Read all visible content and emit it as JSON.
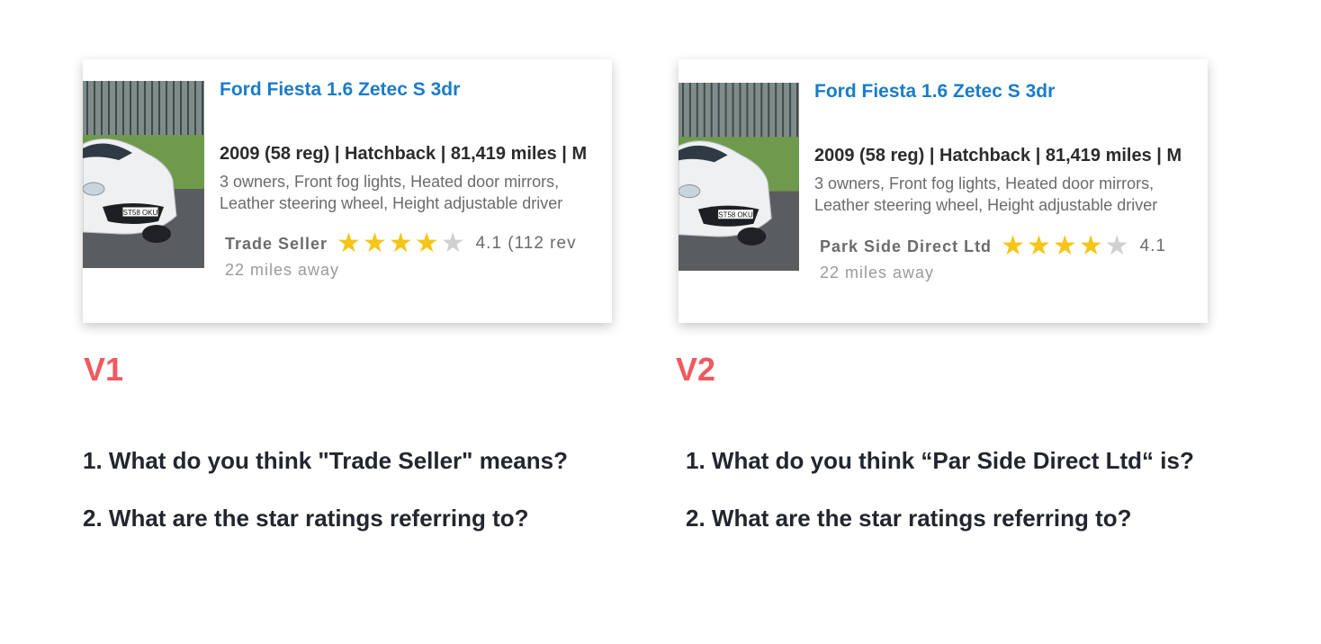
{
  "variants": [
    {
      "label": "V1",
      "card": {
        "title": "Ford Fiesta 1.6 Zetec S 3dr",
        "spec": "2009 (58 reg) | Hatchback | 81,419 miles | M",
        "features_line1": "3 owners, Front fog lights, Heated door mirrors,",
        "features_line2": "Leather steering wheel, Height adjustable driver",
        "seller": "Trade Seller",
        "stars_filled": 4,
        "stars_total": 5,
        "rating_text": "4.1 (112 rev",
        "distance": "22 miles away",
        "plate": "ST58 OKU"
      },
      "questions": [
        "1. What do you think \"Trade Seller\" means?",
        "2. What are the star ratings referring to?"
      ]
    },
    {
      "label": "V2",
      "card": {
        "title": "Ford Fiesta 1.6 Zetec S 3dr",
        "spec": "2009 (58 reg) | Hatchback | 81,419 miles | M",
        "features_line1": "3 owners, Front fog lights, Heated door mirrors,",
        "features_line2": "Leather steering wheel, Height adjustable driver",
        "seller": "Park Side Direct Ltd",
        "stars_filled": 4,
        "stars_total": 5,
        "rating_text": "4.1",
        "distance": "22 miles away",
        "plate": "ST58 OKU"
      },
      "questions": [
        "1. What do you think “Par Side Direct Ltd“ is?",
        "2. What are the star ratings referring to?"
      ]
    }
  ],
  "colors": {
    "title_blue": "#1a7cc8",
    "version_red": "#ef5a5f",
    "star_gold": "#f5c518",
    "star_grey": "#d0d0d0",
    "question_text": "#23262e"
  },
  "icons": {
    "star_filled": "star-filled-icon",
    "star_empty": "star-empty-icon"
  }
}
